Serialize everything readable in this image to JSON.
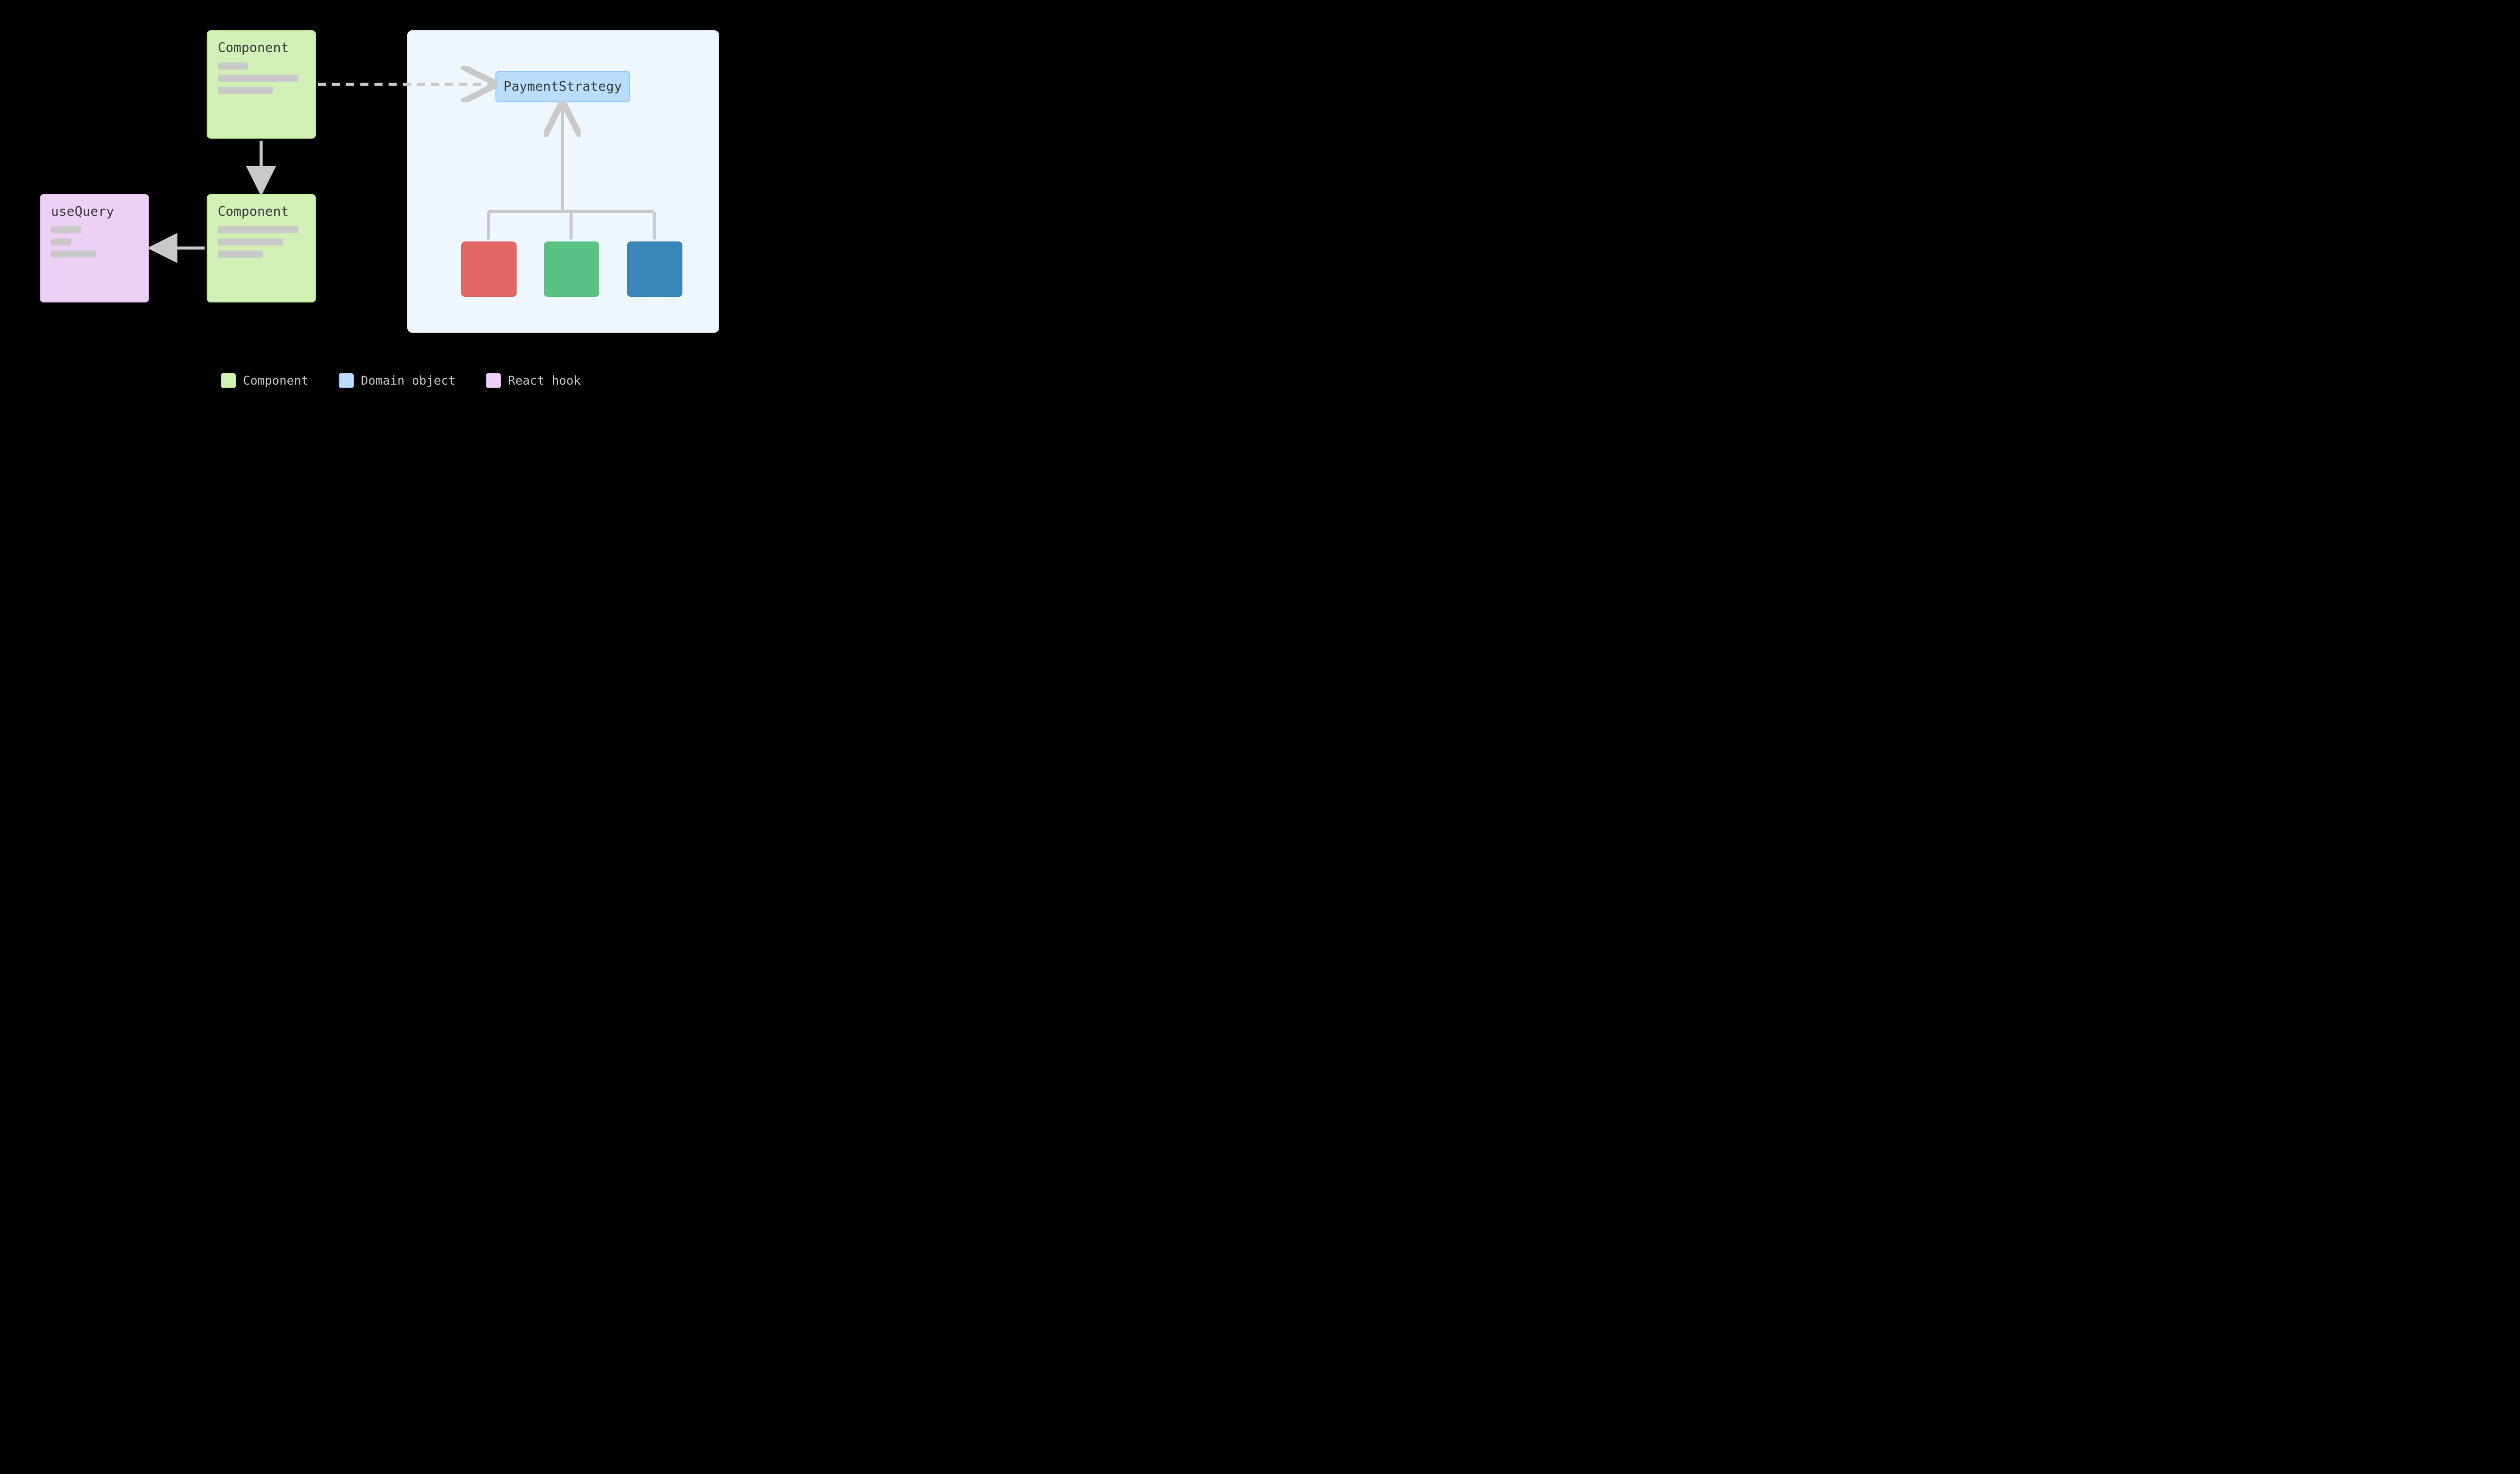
{
  "nodes": {
    "component_top": {
      "label": "Component"
    },
    "component_bottom": {
      "label": "Component"
    },
    "use_query": {
      "label": "useQuery"
    },
    "payment_strategy": {
      "label": "PaymentStrategy"
    }
  },
  "legend": {
    "component": {
      "label": "Component",
      "color": "#d1f0b5",
      "border": "#b7e38d"
    },
    "domain_object": {
      "label": "Domain object",
      "color": "#b9ddfb",
      "border": "#97c9f2"
    },
    "react_hook": {
      "label": "React hook",
      "color": "#eecff5",
      "border": "#e2b6ef"
    }
  },
  "colors": {
    "arrow": "#c9c9c9",
    "placeholder": "#c9c9c9",
    "impl_red": "#e16765",
    "impl_green": "#5bc286",
    "impl_blue": "#3b86b9",
    "panel_bg": "#eef6ff"
  }
}
